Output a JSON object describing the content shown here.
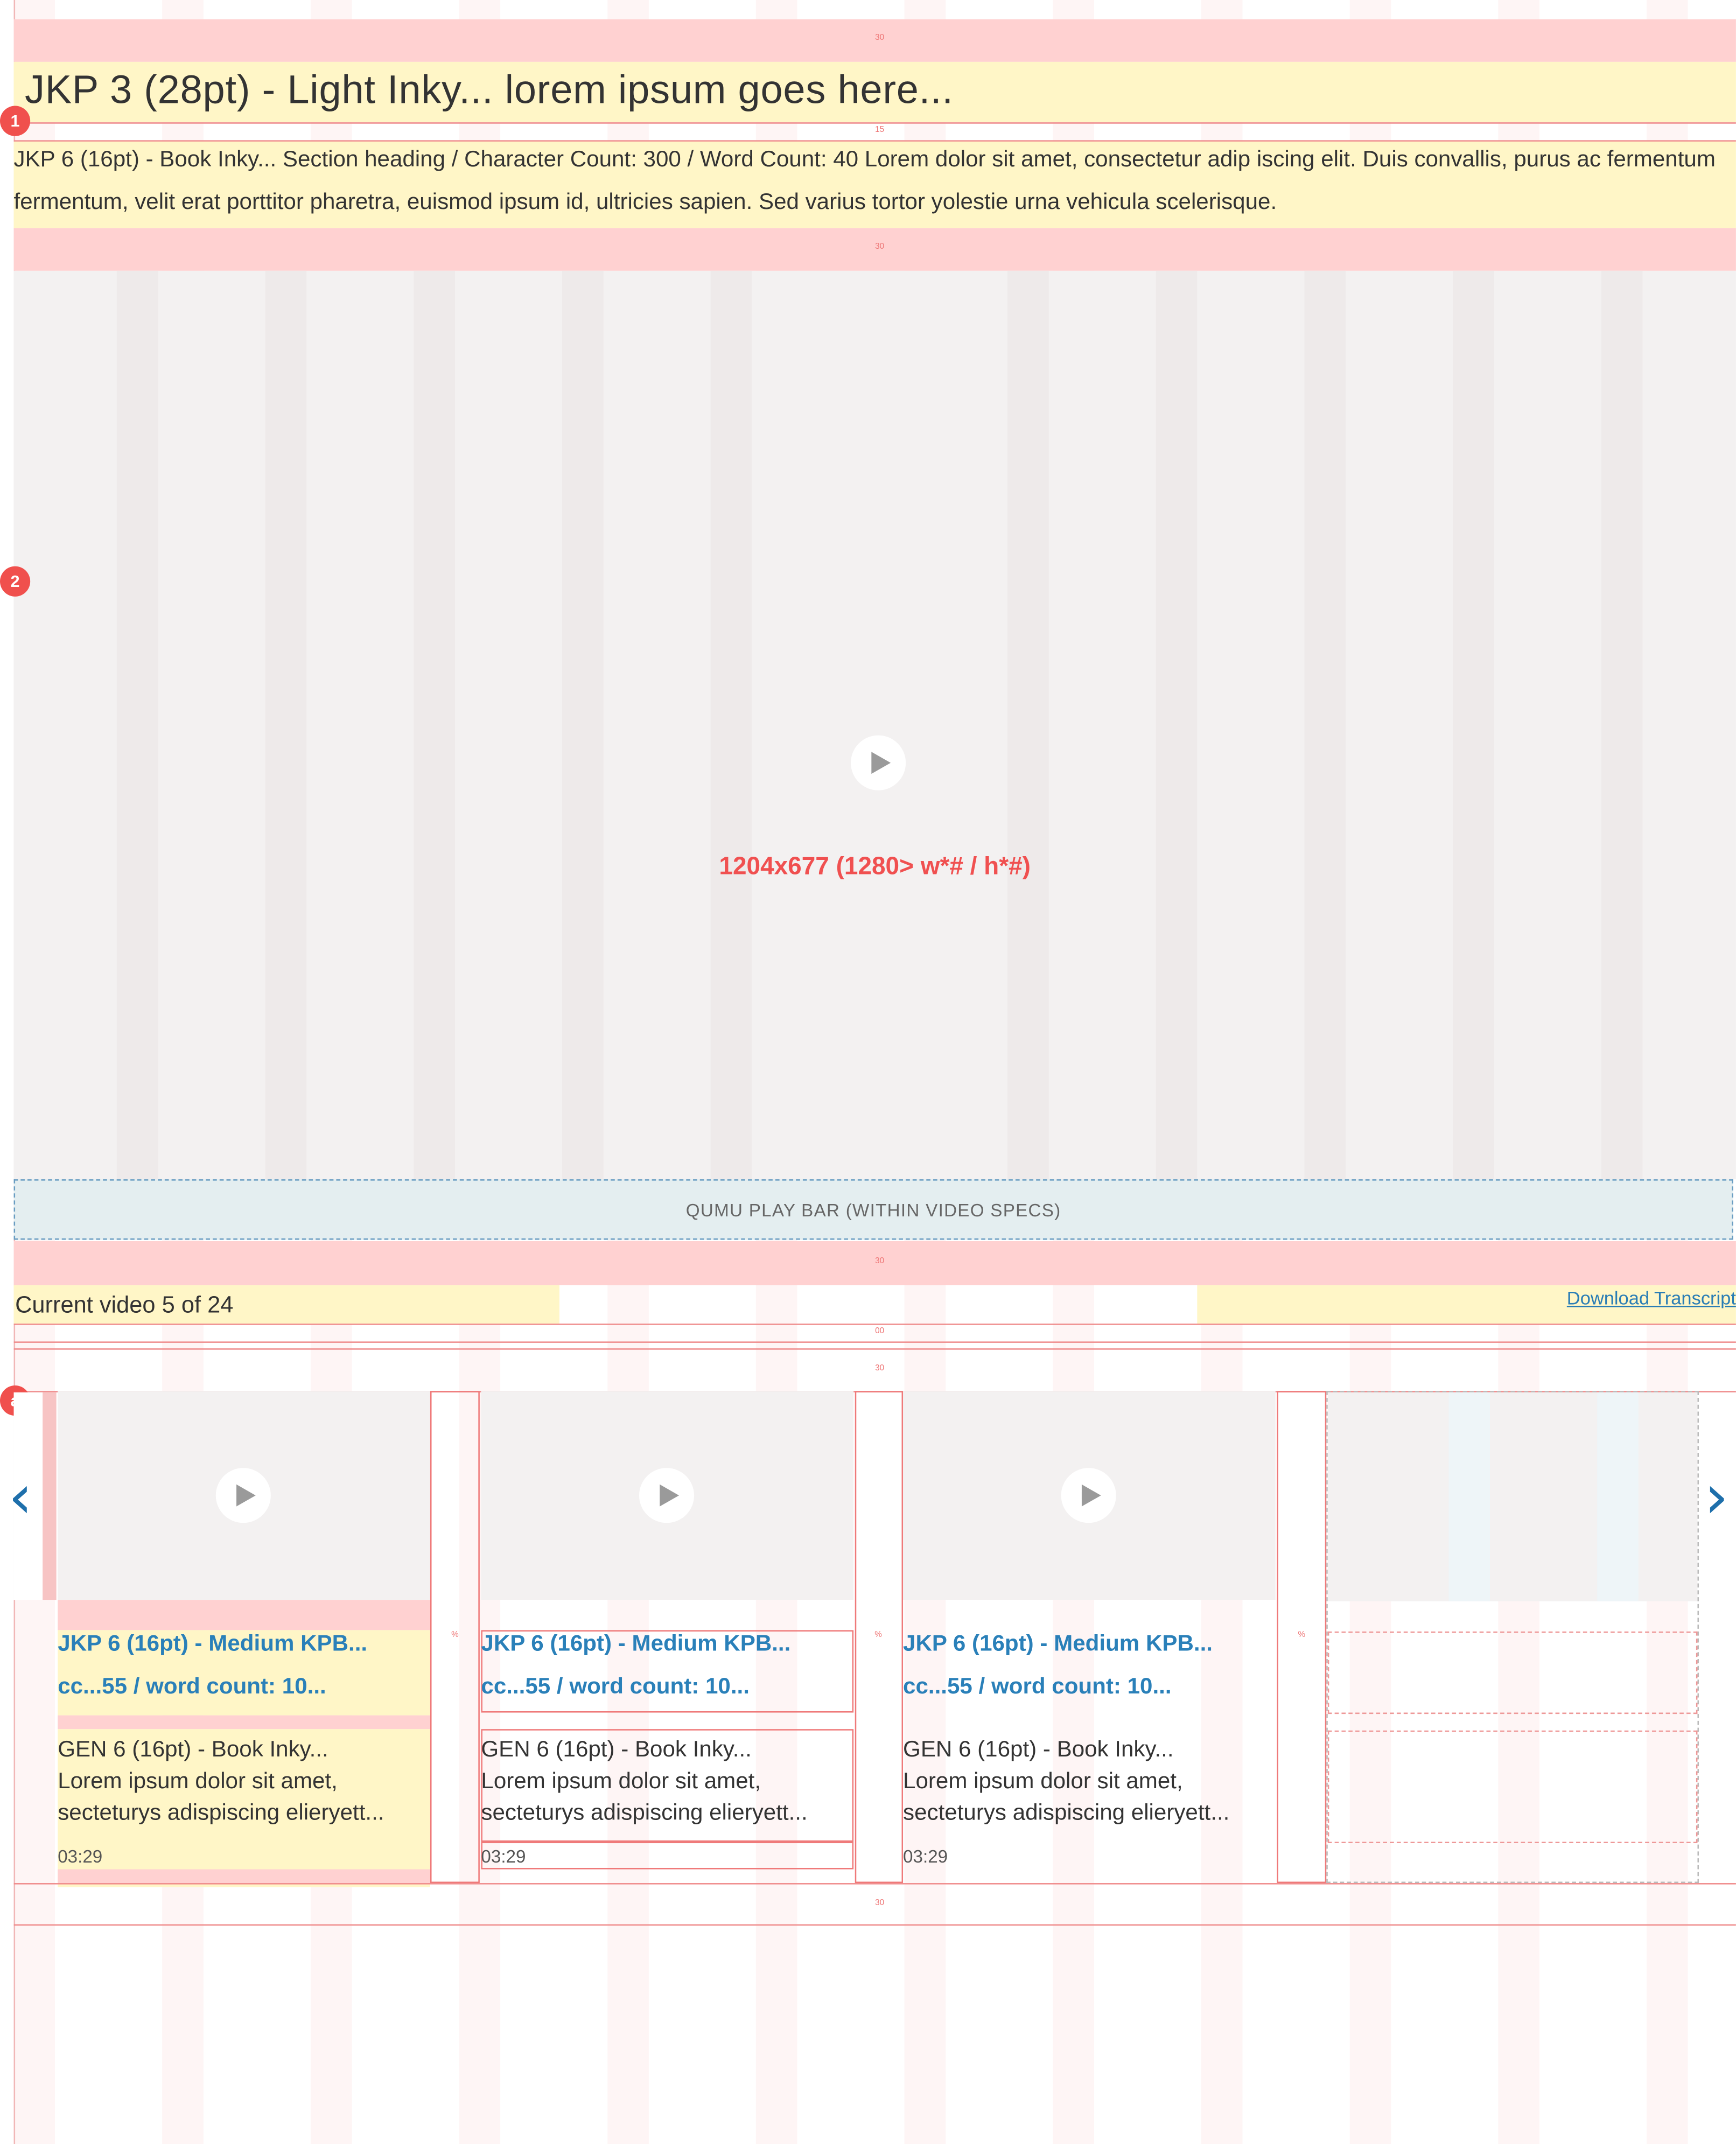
{
  "spec_labels": {
    "spacing_30": "30",
    "spacing_15": "15",
    "spacing_00": "00",
    "spacing_10": "10",
    "spacing_percent": "%"
  },
  "markers": {
    "m1": "1",
    "m2": "2",
    "ma": "a"
  },
  "heading": "JKP 3 (28pt) - Light Inky... lorem ipsum goes here...",
  "intro": "JKP 6 (16pt) - Book Inky... Section heading / Character Count: 300 / Word Count: 40 Lorem dolor sit amet, consectetur adip iscing elit. Duis convallis, purus ac fermentum fermentum, velit erat porttitor pharetra, euismod ipsum id, ultricies sapien. Sed varius tortor yolestie urna vehicula scelerisque.",
  "video": {
    "spec": "1204x677 (1280> w*# / h*#)",
    "play_icon": "play-icon"
  },
  "playbar": "QUMU PLAY BAR (WITHIN VIDEO SPECS)",
  "current_video": "Current video 5 of 24",
  "download": "Download Transcript",
  "carousel": {
    "prev_icon": "chevron-left-icon",
    "next_icon": "chevron-right-icon",
    "prev_glyph": "‹",
    "next_glyph": "›",
    "cards": [
      {
        "title1": "JKP 6 (16pt) - Medium KPB...",
        "title2": "cc...55 / word count: 10...",
        "desc1": "GEN 6 (16pt) - Book Inky...",
        "desc2": "Lorem ipsum dolor sit amet,",
        "desc3": "secteturys adispiscing elieryett...",
        "duration": "03:29"
      },
      {
        "title1": "JKP 6 (16pt) - Medium KPB...",
        "title2": "cc...55 / word count: 10...",
        "desc1": "GEN 6 (16pt) - Book Inky...",
        "desc2": "Lorem ipsum dolor sit amet,",
        "desc3": "secteturys adispiscing elieryett...",
        "duration": "03:29"
      },
      {
        "title1": "JKP 6 (16pt) - Medium KPB...",
        "title2": "cc...55 / word count: 10...",
        "desc1": "GEN 6 (16pt) - Book Inky...",
        "desc2": "Lorem ipsum dolor sit amet,",
        "desc3": "secteturys adispiscing elieryett...",
        "duration": "03:29"
      }
    ]
  }
}
